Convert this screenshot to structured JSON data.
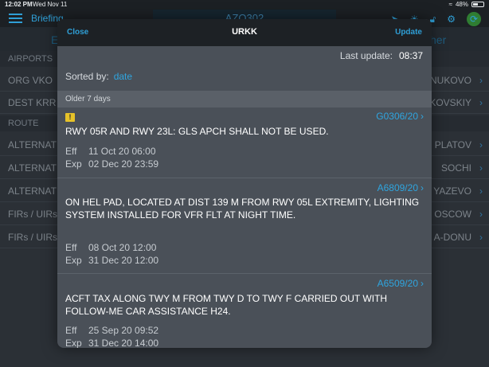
{
  "status_bar": {
    "time": "12:02 PM",
    "date": "Wed Nov 11",
    "battery": "48%",
    "battery_level": 0.48
  },
  "nav": {
    "title": "Briefing",
    "flight": "AZO302"
  },
  "background": {
    "tab_left": "E",
    "tab_right": "her",
    "sections": {
      "airports": "AIRPORTS",
      "route": "ROUTE"
    },
    "rows": [
      {
        "left": "ORG  VKO",
        "right": "NUKOVO"
      },
      {
        "left": "DEST  KRR",
        "right": "KOVSKIY"
      },
      {
        "left": "ALTERNAT",
        "right": "PLATOV"
      },
      {
        "left": "ALTERNAT",
        "right": "SOCHI"
      },
      {
        "left": "ALTERNAT",
        "right": "YAZEVO"
      },
      {
        "left": "FIRs / UIRs",
        "right": "OSCOW"
      },
      {
        "left": "FIRs / UIRs",
        "right": "A-DONU"
      }
    ]
  },
  "modal": {
    "close_label": "Close",
    "title": "URKK",
    "update_label": "Update",
    "last_update_label": "Last update:",
    "last_update_value": "08:37",
    "sorted_label": "Sorted by:",
    "sorted_value": "date",
    "section_label": "Older 7 days",
    "notams": [
      {
        "id": "G0306/20",
        "warning": true,
        "text": "RWY 05R AND RWY 23L: GLS APCH SHALL NOT BE USED.",
        "eff_label": "Eff",
        "eff": "11 Oct 20 06:00",
        "exp_label": "Exp",
        "exp": "02 Dec 20 23:59"
      },
      {
        "id": "A6809/20",
        "warning": false,
        "text": "ON HEL PAD, LOCATED AT DIST 139 M FROM RWY 05L EXTREMITY, LIGHTING\nSYSTEM INSTALLED FOR VFR FLT AT NIGHT TIME.",
        "eff_label": "Eff",
        "eff": "08 Oct 20 12:00",
        "exp_label": "Exp",
        "exp": "31 Dec 20 12:00"
      },
      {
        "id": "A6509/20",
        "warning": false,
        "text": "ACFT TAX ALONG TWY M FROM TWY D TO TWY F CARRIED OUT WITH\nFOLLOW-ME CAR ASSISTANCE H24.",
        "eff_label": "Eff",
        "eff": "25 Sep 20 09:52",
        "exp_label": "Exp",
        "exp": "31 Dec 20 14:00"
      }
    ]
  },
  "icons": {
    "menu": "hamburger-menu-icon",
    "location": "location-arrow-icon",
    "brightness": "brightness-icon",
    "lock": "unlock-icon",
    "settings": "gear-icon",
    "refresh": "refresh-icon",
    "warning": "warning-icon",
    "chevron": "chevron-right-icon"
  },
  "colors": {
    "accent": "#2fa5df",
    "warning": "#e6c229",
    "refresh": "#2f7d32"
  }
}
